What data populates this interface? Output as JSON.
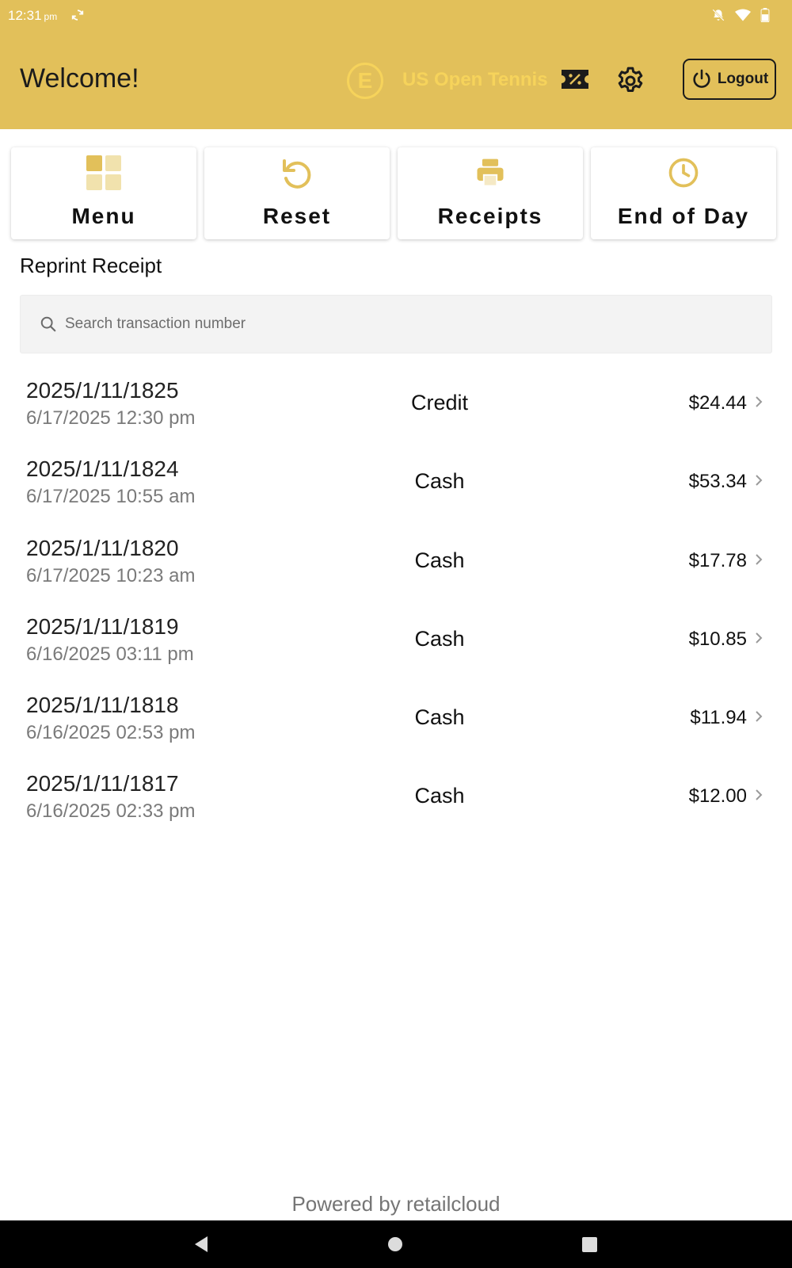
{
  "status_bar": {
    "time": "12:31",
    "ampm": "pm",
    "icons": [
      "sync-icon",
      "notifications-off-icon",
      "wifi-icon",
      "battery-icon"
    ]
  },
  "header": {
    "welcome": "Welcome!",
    "brand_letter": "E",
    "event_name": "US Open Tennis",
    "logout_label": "Logout",
    "icons": [
      "discount-ticket-icon",
      "gear-icon",
      "power-icon"
    ],
    "colors": {
      "header_bg": "#e2c05a",
      "brand_accent": "#f6d35b",
      "dark": "#1b1b1b"
    }
  },
  "tiles": [
    {
      "label": "Menu",
      "icon": "grid-icon"
    },
    {
      "label": "Reset",
      "icon": "reset-icon"
    },
    {
      "label": "Receipts",
      "icon": "printer-icon"
    },
    {
      "label": "End of Day",
      "icon": "clock-icon"
    }
  ],
  "section_title": "Reprint Receipt",
  "search": {
    "placeholder": "Search transaction number",
    "value": ""
  },
  "transactions": [
    {
      "number": "2025/1/11/1825",
      "date": "6/17/2025 12:30 pm",
      "type": "Credit",
      "amount": "$24.44"
    },
    {
      "number": "2025/1/11/1824",
      "date": "6/17/2025 10:55 am",
      "type": "Cash",
      "amount": "$53.34"
    },
    {
      "number": "2025/1/11/1820",
      "date": "6/17/2025 10:23 am",
      "type": "Cash",
      "amount": "$17.78"
    },
    {
      "number": "2025/1/11/1819",
      "date": "6/16/2025 03:11 pm",
      "type": "Cash",
      "amount": "$10.85"
    },
    {
      "number": "2025/1/11/1818",
      "date": "6/16/2025 02:53 pm",
      "type": "Cash",
      "amount": "$11.94"
    },
    {
      "number": "2025/1/11/1817",
      "date": "6/16/2025 02:33 pm",
      "type": "Cash",
      "amount": "$12.00"
    }
  ],
  "footer": {
    "powered_by": "Powered by retailcloud"
  }
}
